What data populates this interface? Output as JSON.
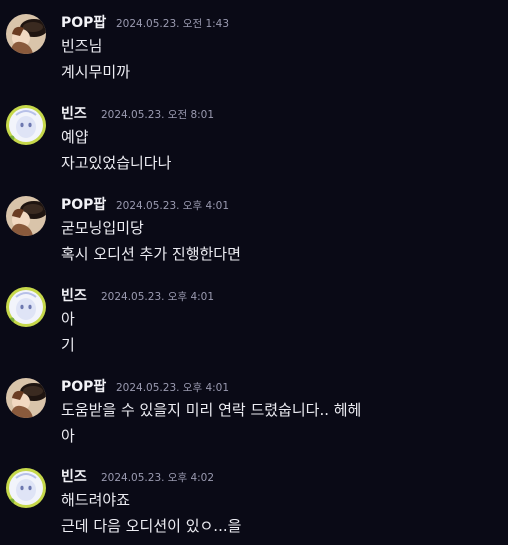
{
  "messages": [
    {
      "author": "POP팝",
      "avatar": "popup-avatar",
      "timestamp": "2024.05.23. 오전 1:43",
      "lines": [
        "빈즈님",
        "계시무미까"
      ]
    },
    {
      "author": "빈즈",
      "avatar": "binz-avatar",
      "timestamp": "2024.05.23. 오전 8:01",
      "lines": [
        "예얍",
        "자고있었습니다나"
      ]
    },
    {
      "author": "POP팝",
      "avatar": "popup-avatar",
      "timestamp": "2024.05.23. 오후 4:01",
      "lines": [
        "굳모닝입미당",
        "혹시 오디션 추가 진행한다면"
      ]
    },
    {
      "author": "빈즈",
      "avatar": "binz-avatar",
      "timestamp": "2024.05.23. 오후 4:01",
      "lines": [
        "아",
        "기"
      ]
    },
    {
      "author": "POP팝",
      "avatar": "popup-avatar",
      "timestamp": "2024.05.23. 오후 4:01",
      "lines": [
        "도움받을 수 있을지 미리 연락 드렸숩니다.. 헤헤",
        "아"
      ]
    },
    {
      "author": "빈즈",
      "avatar": "binz-avatar",
      "timestamp": "2024.05.23. 오후 4:02",
      "lines": [
        "해드려야죠",
        "근데 다음 오디션이 있ㅇ...을"
      ]
    }
  ]
}
